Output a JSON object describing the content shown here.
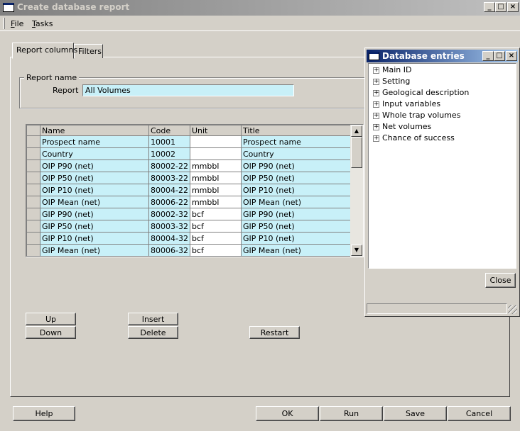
{
  "window": {
    "title": "Create database report",
    "min": "_",
    "max": "□",
    "close": "×"
  },
  "menu": {
    "file_u": "F",
    "file_rest": "ile",
    "tasks_u": "T",
    "tasks_rest": "asks"
  },
  "tabs": {
    "report_columns": "Report columns",
    "filters": "Filters"
  },
  "report_name": {
    "group_label": "Report name",
    "label": "Report",
    "value": "All Volumes"
  },
  "grid": {
    "headers": [
      "Name",
      "Code",
      "Unit",
      "Title"
    ],
    "rows": [
      [
        "Prospect name",
        "10001",
        "",
        "Prospect name"
      ],
      [
        "Country",
        "10002",
        "",
        "Country"
      ],
      [
        "OIP P90 (net)",
        "80002-22",
        "mmbbl",
        "OIP P90 (net)"
      ],
      [
        "OIP P50 (net)",
        "80003-22",
        "mmbbl",
        "OIP P50 (net)"
      ],
      [
        "OIP P10 (net)",
        "80004-22",
        "mmbbl",
        "OIP P10 (net)"
      ],
      [
        "OIP Mean (net)",
        "80006-22",
        "mmbbl",
        "OIP Mean (net)"
      ],
      [
        "GIP P90 (net)",
        "80002-32",
        "bcf",
        "GIP P90 (net)"
      ],
      [
        "GIP P50 (net)",
        "80003-32",
        "bcf",
        "GIP P50 (net)"
      ],
      [
        "GIP P10 (net)",
        "80004-32",
        "bcf",
        "GIP P10 (net)"
      ],
      [
        "GIP Mean (net)",
        "80006-32",
        "bcf",
        "GIP Mean (net)"
      ]
    ],
    "scroll_up": "▲",
    "scroll_down": "▼"
  },
  "buttons": {
    "up": "Up",
    "down": "Down",
    "insert": "Insert",
    "delete": "Delete",
    "restart": "Restart",
    "help": "Help",
    "ok": "OK",
    "run": "Run",
    "save": "Save",
    "cancel": "Cancel"
  },
  "db_window": {
    "title": "Database entries",
    "items": [
      "Main ID",
      "Setting",
      "Geological description",
      "Input variables",
      "Whole trap volumes",
      "Net volumes",
      "Chance of success"
    ],
    "expander": "+",
    "close_button": "Close"
  },
  "colors": {
    "cell_cyan": "#c8f0f8",
    "inactive_title": "#808080",
    "active_title": "#0a246a"
  }
}
